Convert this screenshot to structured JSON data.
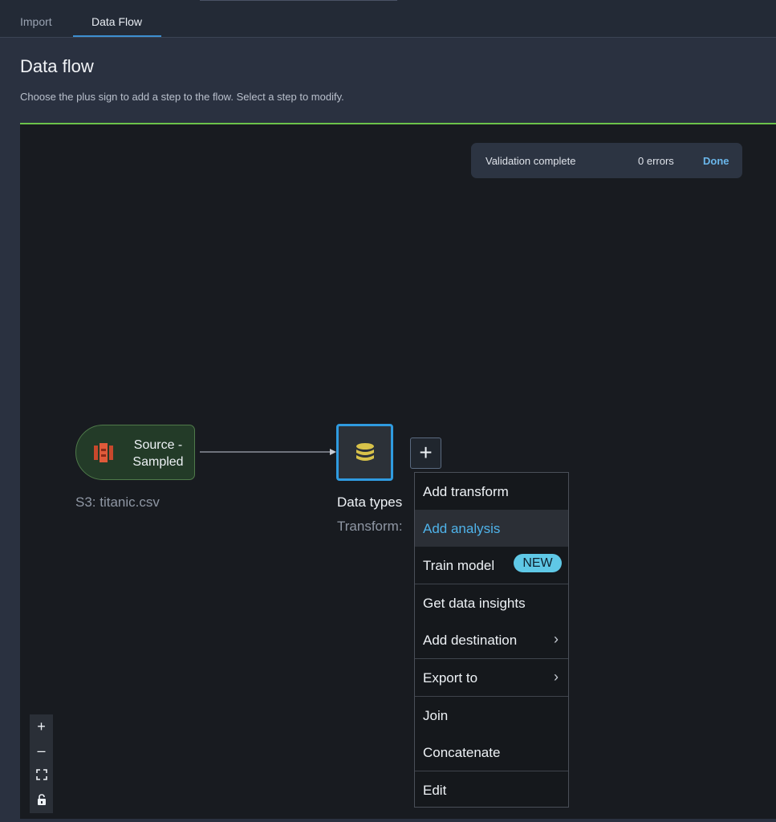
{
  "tabs": [
    {
      "label": "Import"
    },
    {
      "label": "Data Flow",
      "active": true
    }
  ],
  "header": {
    "title": "Data flow",
    "subtitle": "Choose the plus sign to add a step to the flow. Select a step to modify."
  },
  "validation": {
    "label": "Validation complete",
    "count": "0 errors",
    "action": "Done"
  },
  "nodes": {
    "source": {
      "label_line1": "Source -",
      "label_line2": "Sampled",
      "sublabel": "S3: titanic.csv",
      "icon": "s3-bucket-icon"
    },
    "transform": {
      "label": "Data types",
      "sublabel": "Transform:",
      "icon": "database-icon"
    }
  },
  "add_button": {
    "symbol": "+"
  },
  "menu": {
    "items": [
      {
        "label": "Add transform"
      },
      {
        "label": "Add analysis",
        "highlighted": true
      },
      {
        "label": "Train model",
        "badge": "NEW"
      },
      {
        "label": "Get data insights"
      },
      {
        "label": "Add destination",
        "submenu": true
      },
      {
        "label": "Export to",
        "submenu": true
      },
      {
        "label": "Join"
      },
      {
        "label": "Concatenate"
      },
      {
        "label": "Edit"
      }
    ]
  },
  "zoom_controls": {
    "zoom_in": "+",
    "zoom_out": "–",
    "fit": "fit-view-icon",
    "lock": "lock-icon"
  },
  "colors": {
    "accent": "#3d8fd1",
    "valid": "#6cc24a",
    "highlight_text": "#4fb3ea",
    "badge": "#5fc8e6"
  }
}
